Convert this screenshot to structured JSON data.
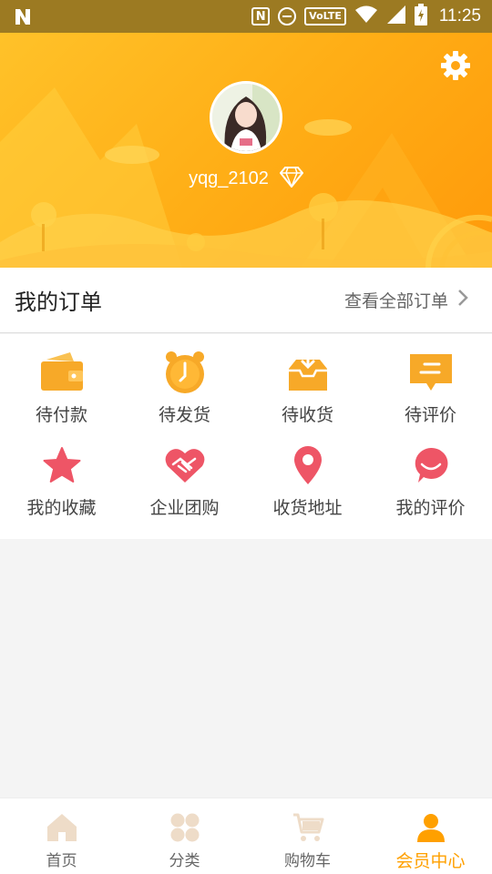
{
  "status_bar": {
    "time": "11:25",
    "volte": "VoLTE",
    "icons": [
      "n-logo-icon",
      "nfc-icon",
      "do-not-disturb-icon",
      "volte-icon",
      "wifi-icon",
      "signal-icon",
      "battery-icon"
    ]
  },
  "profile": {
    "username": "yqg_2102",
    "member_badge": "diamond-icon"
  },
  "orders": {
    "title": "我的订单",
    "view_all": "查看全部订单"
  },
  "order_status": [
    {
      "label": "待付款",
      "icon": "wallet-icon"
    },
    {
      "label": "待发货",
      "icon": "clock-icon"
    },
    {
      "label": "待收货",
      "icon": "inbox-icon"
    },
    {
      "label": "待评价",
      "icon": "comment-icon"
    }
  ],
  "services": [
    {
      "label": "我的收藏",
      "icon": "star-icon"
    },
    {
      "label": "企业团购",
      "icon": "handshake-heart-icon"
    },
    {
      "label": "收货地址",
      "icon": "location-pin-icon"
    },
    {
      "label": "我的评价",
      "icon": "smile-bubble-icon"
    }
  ],
  "bottom_nav": [
    {
      "label": "首页",
      "icon": "home-icon",
      "active": false
    },
    {
      "label": "分类",
      "icon": "category-icon",
      "active": false
    },
    {
      "label": "购物车",
      "icon": "cart-icon",
      "active": false
    },
    {
      "label": "会员中心",
      "icon": "member-icon",
      "active": true
    }
  ],
  "colors": {
    "accent": "#ffa000",
    "header_gradient_start": "#ffc229",
    "header_gradient_end": "#ff9a0a",
    "icon_orange": "#f7a928",
    "icon_red": "#ee5566"
  }
}
